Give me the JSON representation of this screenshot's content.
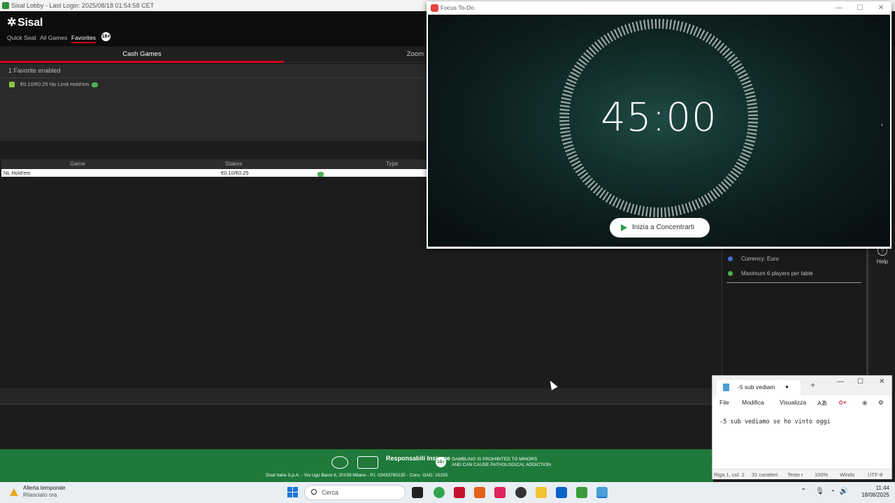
{
  "sisal": {
    "window_title": "Sisal Lobby - Last Login: 2025/08/18 01:54:58 CET",
    "logo": "Sisal",
    "nav": [
      "Quick Seat",
      "All Games",
      "Favorites"
    ],
    "age_badge": "18+",
    "tabs": {
      "cash": "Cash Games",
      "zoom": "Zoom"
    },
    "favorites": {
      "title": "1 Favorite enabled",
      "item": "€0.10/€0.25  No Limit Hold'em"
    },
    "table": {
      "headers": [
        "Game",
        "Stakes",
        "Type"
      ],
      "rows": [
        {
          "game": "NL Hold'em",
          "stakes": "€0.10/€0.25"
        }
      ]
    },
    "footer": {
      "responsible": "Responsabili Insieme",
      "age": "18+",
      "gambling_notice_1": "GAMBLING IS PROHIBITED TO MINORS",
      "gambling_notice_2": "AND CAN CAUSE PATHOLOGICAL ADDICTION",
      "legal": "Sisal Italia S.p.A. - Via Ugo Bassi 6, 20159 Milano - P.I. 02433760135 - Conc. GAD: 15155"
    },
    "right_panel": {
      "items": [
        "Currency: Euro",
        "Maximum 6 players per table"
      ],
      "help": "Help"
    }
  },
  "focus": {
    "window_title": "Focus To-Do",
    "timer": "45:00",
    "start_button": "Inizia a Concentrarti"
  },
  "notepad": {
    "tab_title": "-5 sub vediam",
    "menu": [
      "File",
      "Modifica",
      "Visualizza"
    ],
    "content": "-5 sub vediamo se ho vinto oggi",
    "status": {
      "position": "Riga 1, col. 2",
      "chars": "31 caratteri",
      "format": "Testo r",
      "zoom": "100%",
      "eol": "Windo",
      "encoding": "UTF-8"
    }
  },
  "taskbar": {
    "weather_title": "Allerta temporale",
    "weather_sub": "Rilasciato ora",
    "search_placeholder": "Cerca",
    "time": "11:44",
    "date": "18/08/2025"
  }
}
